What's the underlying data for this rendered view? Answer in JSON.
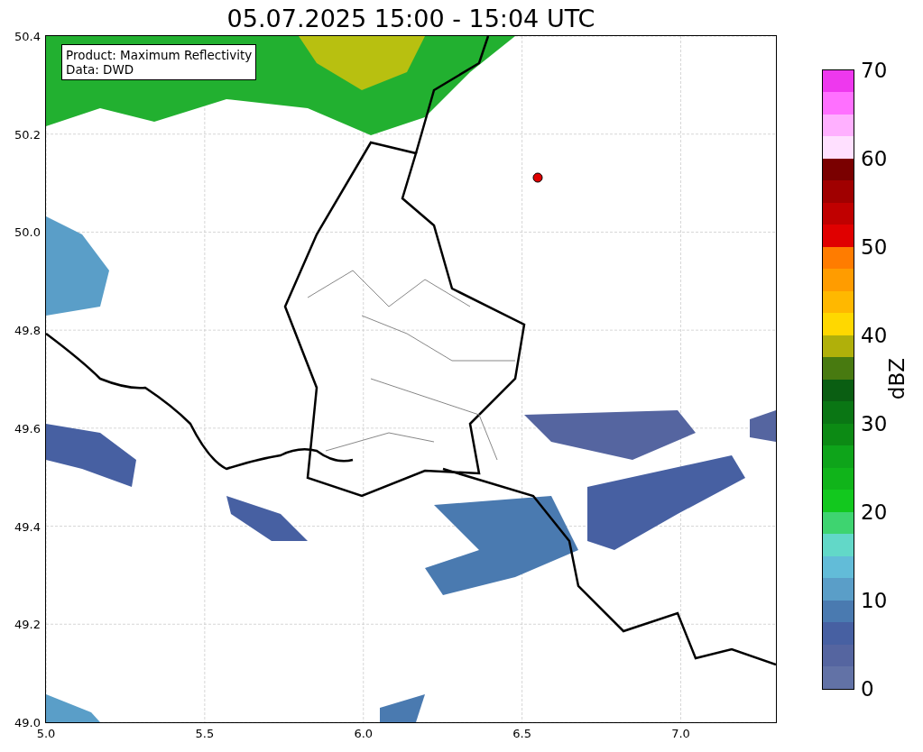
{
  "title": "05.07.2025 15:00 - 15:04 UTC",
  "map": {
    "info_box": [
      "Product: Maximum Reflectivity",
      "Data: DWD"
    ],
    "x_ticks": [
      "5.0",
      "5.5",
      "6.0",
      "6.5",
      "7.0"
    ],
    "y_ticks": [
      "50.4",
      "50.2",
      "50.0",
      "49.8",
      "49.6",
      "49.4",
      "49.2",
      "49.0"
    ]
  },
  "colorbar": {
    "label": "dBZ",
    "ticks": [
      "70",
      "60",
      "50",
      "40",
      "30",
      "20",
      "10",
      "0"
    ],
    "bands": [
      {
        "color": "#ee38ee"
      },
      {
        "color": "#ff70ff"
      },
      {
        "color": "#ffb0ff"
      },
      {
        "color": "#ffe0ff"
      },
      {
        "color": "#7a0000"
      },
      {
        "color": "#a00000"
      },
      {
        "color": "#c00000"
      },
      {
        "color": "#e00000"
      },
      {
        "color": "#ff7c00"
      },
      {
        "color": "#ff9c00"
      },
      {
        "color": "#ffb800"
      },
      {
        "color": "#ffd800"
      },
      {
        "color": "#b0b00a"
      },
      {
        "color": "#487a10"
      },
      {
        "color": "#0a5e12"
      },
      {
        "color": "#0a7614"
      },
      {
        "color": "#0c8a14"
      },
      {
        "color": "#0ea41a"
      },
      {
        "color": "#10b41a"
      },
      {
        "color": "#12c81e"
      },
      {
        "color": "#3ed470"
      },
      {
        "color": "#62d8c8"
      },
      {
        "color": "#62bcd8"
      },
      {
        "color": "#5a9ec8"
      },
      {
        "color": "#4a7ab0"
      },
      {
        "color": "#4760a2"
      },
      {
        "color": "#5565a0"
      },
      {
        "color": "#6272a6"
      }
    ]
  }
}
